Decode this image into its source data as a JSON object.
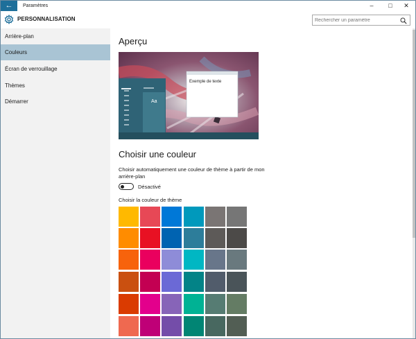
{
  "window": {
    "title": "Paramètres"
  },
  "header": {
    "section_title": "PERSONNALISATION",
    "search_placeholder": "Rechercher un paramètre"
  },
  "sidebar": {
    "items": [
      {
        "label": "Arrière-plan",
        "active": false
      },
      {
        "label": "Couleurs",
        "active": true
      },
      {
        "label": "Écran de verrouillage",
        "active": false
      },
      {
        "label": "Thèmes",
        "active": false
      },
      {
        "label": "Démarrer",
        "active": false
      }
    ]
  },
  "main": {
    "preview_heading": "Aperçu",
    "preview_sample_text": "Exemple de texte",
    "preview_tile_text": "Aa",
    "choose_heading": "Choisir une couleur",
    "auto_color_label": "Choisir automatiquement une couleur de thème à partir de mon arrière-plan",
    "toggle_state": "Désactivé",
    "theme_color_label": "Choisir la couleur de thème"
  },
  "colors": {
    "accent": "#1e6f9a",
    "selected_nav": "#a9c4d4",
    "swatch_rows": [
      [
        "#ffb900",
        "#e74856",
        "#0078d7",
        "#0099bc",
        "#7a7574",
        "#767676"
      ],
      [
        "#ff8c00",
        "#e81123",
        "#0063b1",
        "#2d7d9a",
        "#5d5a58",
        "#4c4a48"
      ],
      [
        "#f7630c",
        "#ea005e",
        "#8e8cd8",
        "#00b7c3",
        "#68768a",
        "#69797e"
      ],
      [
        "#ca5010",
        "#c30052",
        "#6b69d6",
        "#038387",
        "#515c6b",
        "#4a5459"
      ],
      [
        "#da3b01",
        "#e3008c",
        "#8764b8",
        "#00b294",
        "#567c73",
        "#647c64"
      ],
      [
        "#ef6950",
        "#bf0077",
        "#744da9",
        "#018574",
        "#486860",
        "#525e54"
      ]
    ]
  }
}
